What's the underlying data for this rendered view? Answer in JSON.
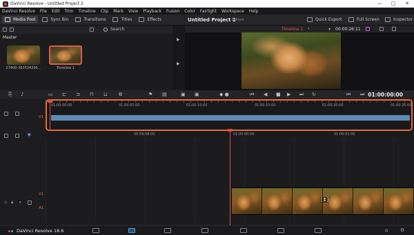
{
  "window": {
    "title": "DaVinci Resolve - Untitled Project 2",
    "controls": [
      "—",
      "□",
      "✕"
    ]
  },
  "menu": [
    "DaVinci Resolve",
    "File",
    "Edit",
    "Trim",
    "Timeline",
    "Clip",
    "Mark",
    "View",
    "Playback",
    "Fusion",
    "Color",
    "Fairlight",
    "Workspace",
    "Help"
  ],
  "toolbar": {
    "media_pool": "Media Pool",
    "sync_bin": "Sync Bin",
    "transitions": "Transitions",
    "titles": "Titles",
    "effects": "Effects",
    "project_title": "Untitled Project 2",
    "edited": "Edited",
    "quick_export": "Quick Export",
    "full_screen": "Full Screen",
    "inspector": "Inspector"
  },
  "media_pool": {
    "search_label": "Search",
    "folder": "Master",
    "clips": [
      {
        "label": "27400-363534295..."
      },
      {
        "label": "Timeline 1"
      }
    ]
  },
  "viewer": {
    "timeline_name": "Timeline 1",
    "timecode": "00:00:26:11"
  },
  "transport": {
    "timecode": "01:00:00:00"
  },
  "upper_timeline": {
    "ruler": [
      "01:00:00:00",
      "01:00:05:00",
      "01:00:10:00",
      "01:00:15:00",
      "01:00:20:00",
      "01:00:25:00"
    ],
    "track": "V1"
  },
  "lower_timeline": {
    "ruler": [
      "00:59:58:00",
      "01:00:00:00",
      "01:00:02:00"
    ],
    "video_track": "V1",
    "audio_track": "A1"
  },
  "bottom": {
    "brand": "DaVinci Resolve 18.6"
  },
  "colors": {
    "accent_red": "#e84a3f",
    "selection_orange": "#e86a3e",
    "clip_blue": "#5d8bb5"
  }
}
